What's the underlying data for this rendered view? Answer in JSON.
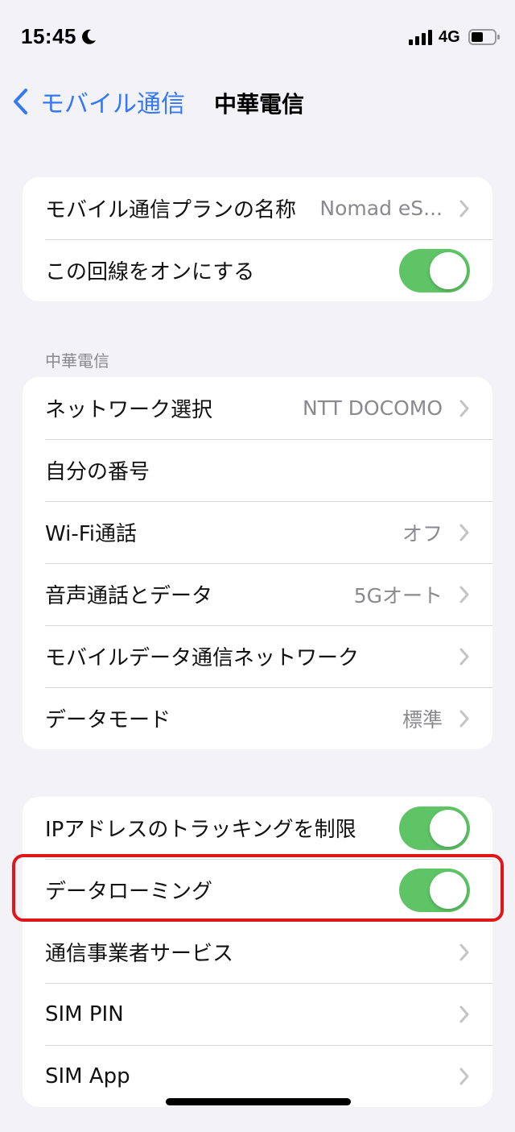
{
  "status": {
    "time": "15:45",
    "network": "4G",
    "icons": [
      "moon-icon",
      "signal-icon",
      "battery-icon"
    ]
  },
  "nav": {
    "back_label": "モバイル通信",
    "title": "中華電信"
  },
  "group1": {
    "plan_label": "モバイル通信プランの名称",
    "plan_value": "Nomad eS...",
    "line_on_label": "この回線をオンにする",
    "line_on_state": "on"
  },
  "section_header": "中華電信",
  "group2": {
    "items": [
      {
        "label": "ネットワーク選択",
        "value": "NTT DOCOMO"
      },
      {
        "label": "自分の番号",
        "value": ""
      },
      {
        "label": "Wi-Fi通話",
        "value": "オフ"
      },
      {
        "label": "音声通話とデータ",
        "value": "5Gオート"
      },
      {
        "label": "モバイルデータ通信ネットワーク",
        "value": ""
      },
      {
        "label": "データモード",
        "value": "標準"
      }
    ]
  },
  "group3": {
    "ip_tracking_label": "IPアドレスのトラッキングを制限",
    "ip_tracking_state": "on",
    "roaming_label": "データローミング",
    "roaming_state": "on",
    "carrier_services_label": "通信事業者サービス",
    "sim_pin_label": "SIM PIN",
    "sim_app_label": "SIM App"
  },
  "colors": {
    "accent": "#3478f6",
    "toggle_on": "#5ec465",
    "highlight": "#e0161b",
    "background": "#f2f2f7"
  }
}
